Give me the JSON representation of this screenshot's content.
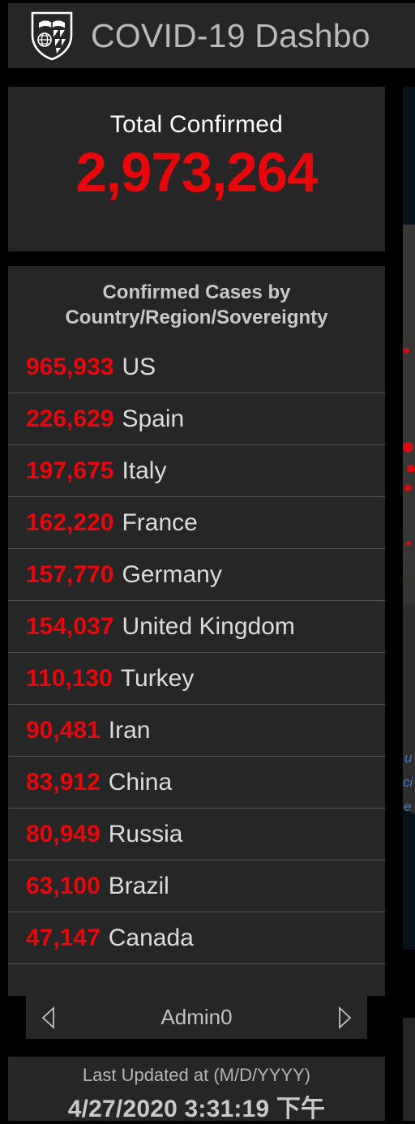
{
  "header": {
    "logo_icon": "jhu-shield-icon",
    "title": "COVID-19 Dashbo"
  },
  "total": {
    "label": "Total Confirmed",
    "value": "2,973,264"
  },
  "country_list": {
    "title_line1": "Confirmed Cases by",
    "title_line2": "Country/Region/Sovereignty",
    "rows": [
      {
        "count": "965,933",
        "name": "US"
      },
      {
        "count": "226,629",
        "name": "Spain"
      },
      {
        "count": "197,675",
        "name": "Italy"
      },
      {
        "count": "162,220",
        "name": "France"
      },
      {
        "count": "157,770",
        "name": "Germany"
      },
      {
        "count": "154,037",
        "name": "United Kingdom"
      },
      {
        "count": "110,130",
        "name": "Turkey"
      },
      {
        "count": "90,481",
        "name": "Iran"
      },
      {
        "count": "83,912",
        "name": "China"
      },
      {
        "count": "80,949",
        "name": "Russia"
      },
      {
        "count": "63,100",
        "name": "Brazil"
      },
      {
        "count": "47,147",
        "name": "Canada"
      }
    ]
  },
  "pager": {
    "prev_icon": "chevron-left-icon",
    "next_icon": "chevron-right-icon",
    "label": "Admin0"
  },
  "footer": {
    "label": "Last Updated at (M/D/YYYY)",
    "value": "4/27/2020 3:31:19 下午"
  },
  "map": {
    "link_fragments": [
      "u",
      "ci",
      "e"
    ]
  },
  "colors": {
    "accent_red": "#e8080b",
    "panel_bg": "#262626",
    "page_bg": "#000000",
    "text_light": "#dcdcdc",
    "map_bg": "#07121c",
    "link_blue": "#3f79d6"
  }
}
